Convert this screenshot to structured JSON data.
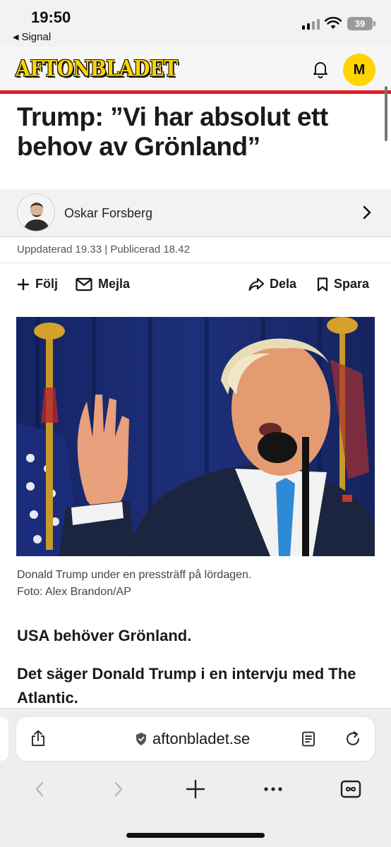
{
  "status": {
    "time": "19:50",
    "back_app": "Signal",
    "battery": "39"
  },
  "header": {
    "logo": "AFTONBLADET",
    "profile_initial": "M"
  },
  "article": {
    "headline": "Trump: ”Vi har absolut ett behov av Grönland”",
    "author": "Oskar Forsberg",
    "timestamp": "Uppdaterad 19.33 | Publicerad 18.42",
    "caption_line1": "Donald Trump under en pressträff på lördagen.",
    "caption_line2": "Foto: Alex Brandon/AP",
    "lead": "USA behöver Grönland.",
    "body": "Det säger Donald Trump i en intervju med The Atlantic."
  },
  "actions": {
    "follow": "Följ",
    "email": "Mejla",
    "share": "Dela",
    "save": "Spara"
  },
  "browser": {
    "url": "aftonbladet.se"
  },
  "colors": {
    "brand_yellow": "#ffd400",
    "brand_red": "#e21a23"
  }
}
